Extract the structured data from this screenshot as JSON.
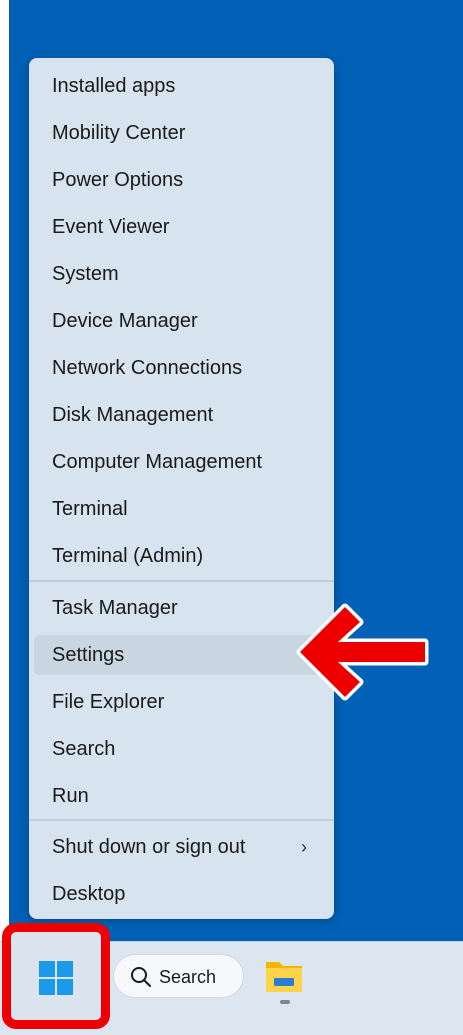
{
  "context_menu": {
    "group1": [
      "Installed apps",
      "Mobility Center",
      "Power Options",
      "Event Viewer",
      "System",
      "Device Manager",
      "Network Connections",
      "Disk Management",
      "Computer Management",
      "Terminal",
      "Terminal (Admin)"
    ],
    "group2": [
      "Task Manager",
      "Settings",
      "File Explorer",
      "Search",
      "Run"
    ],
    "group3": [
      "Shut down or sign out",
      "Desktop"
    ],
    "highlighted_item": "Settings"
  },
  "taskbar": {
    "search_label": "Search"
  },
  "icons": {
    "start": "windows-logo-icon",
    "search": "search-icon",
    "file_explorer": "file-explorer-icon",
    "submenu": "chevron-right-icon"
  },
  "colors": {
    "desktop": "#0161b6",
    "menu": "#d7e3ef",
    "highlight": "#ee0000",
    "taskbar": "#dce6f0"
  }
}
